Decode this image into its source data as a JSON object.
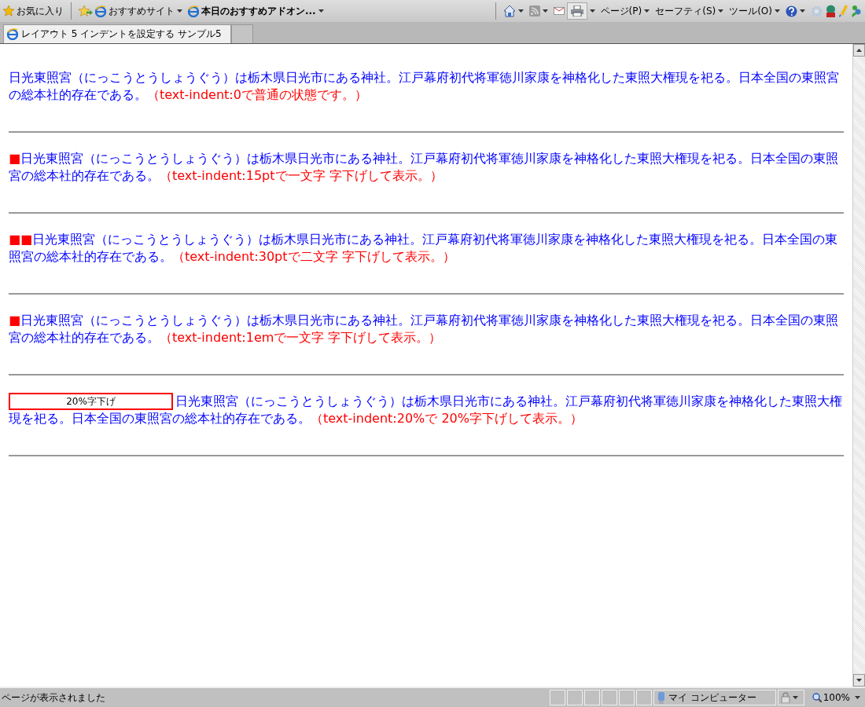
{
  "toolbar": {
    "favorites": "お気に入り",
    "links": [
      {
        "label": "おすすめサイト",
        "bold": false
      },
      {
        "label": "本日のおすすめアドオン...",
        "bold": true
      }
    ],
    "commands": [
      "ページ(P)",
      "セーフティ(S)",
      "ツール(O)"
    ]
  },
  "tabs": [
    {
      "title": "レイアウト 5 インデントを設定する サンプル5",
      "selected": true
    }
  ],
  "paragraphs": [
    {
      "kind": "plain",
      "text": "日光東照宮（にっこうとうしょうぐう）は栃木県日光市にある神社。江戸幕府初代将軍徳川家康を神格化した東照大権現を祀る。日本全国の東照宮の総本社的存在である。",
      "note": "（text-indent:0で普通の状態です。）"
    },
    {
      "kind": "squares",
      "marker": "■",
      "text": "日光東照宮（にっこうとうしょうぐう）は栃木県日光市にある神社。江戸幕府初代将軍徳川家康を神格化した東照大権現を祀る。日本全国の東照宮の総本社的存在である。",
      "note": "（text-indent:15ptで一文字 字下げして表示。）"
    },
    {
      "kind": "squares",
      "marker": "■■",
      "text": "日光東照宮（にっこうとうしょうぐう）は栃木県日光市にある神社。江戸幕府初代将軍徳川家康を神格化した東照大権現を祀る。日本全国の東照宮の総本社的存在である。",
      "note": "（text-indent:30ptで二文字 字下げして表示。）"
    },
    {
      "kind": "squares",
      "marker": "■",
      "text": "日光東照宮（にっこうとうしょうぐう）は栃木県日光市にある神社。江戸幕府初代将軍徳川家康を神格化した東照大権現を祀る。日本全国の東照宮の総本社的存在である。",
      "note": "（text-indent:1emで一文字 字下げして表示。）"
    },
    {
      "kind": "box",
      "marker": "20%字下げ",
      "text": "日光東照宮（にっこうとうしょうぐう）は栃木県日光市にある神社。江戸幕府初代将軍徳川家康を神格化した東照大権現を祀る。日本全国の東照宮の総本社的存在である。",
      "note": "（text-indent:20%で 20%字下げして表示。）"
    }
  ],
  "status_bar": {
    "message": "ページが表示されました",
    "zone": "マイ コンピューター",
    "zoom": "100%"
  }
}
